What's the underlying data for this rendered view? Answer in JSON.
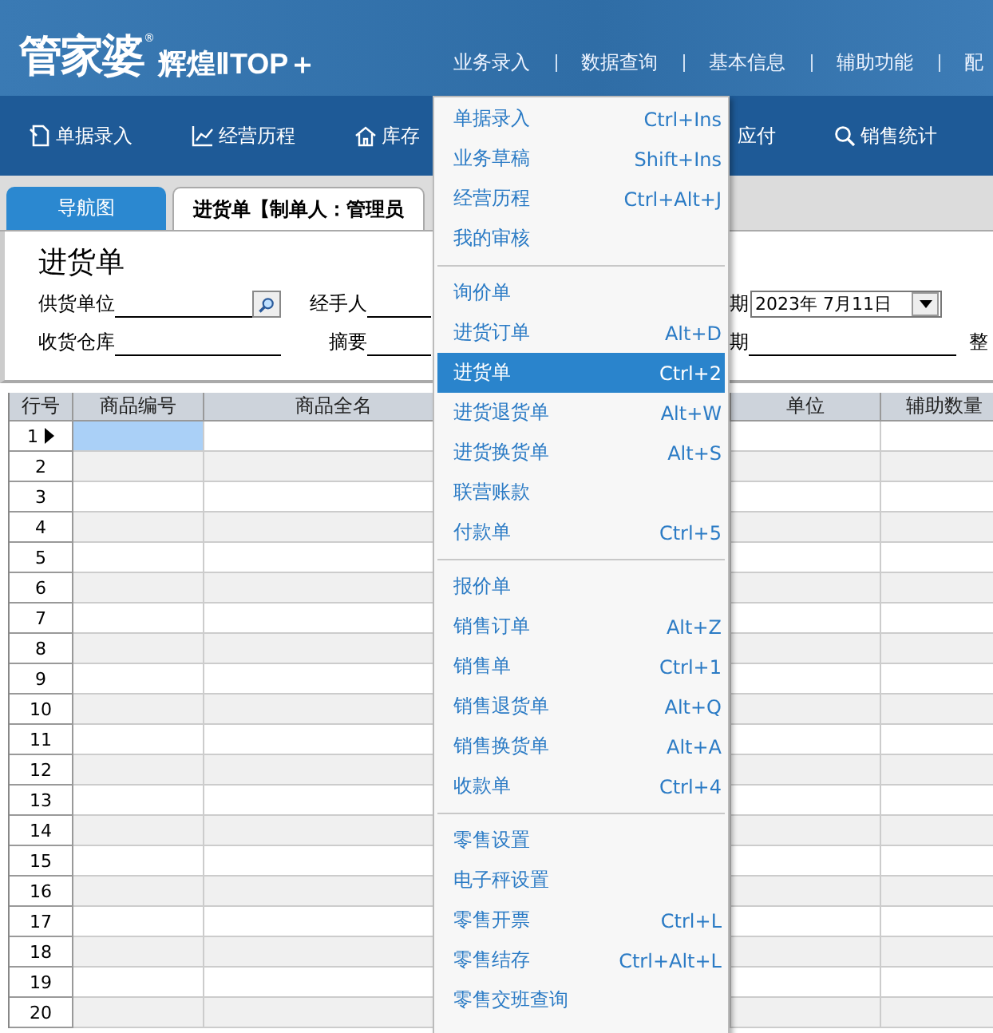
{
  "logo": {
    "brand": "管家婆",
    "mark": "®",
    "edition": "辉煌ⅡTOP＋"
  },
  "top_menu": [
    "业务录入",
    "数据查询",
    "基本信息",
    "辅助功能",
    "配"
  ],
  "toolbar": [
    "单据录入",
    "经营历程",
    "库存",
    "应付",
    "销售统计"
  ],
  "tabs": [
    {
      "label": "导航图",
      "selected": false
    },
    {
      "label": "进货单【制单人：管理员",
      "selected": true
    }
  ],
  "form": {
    "title": "进货单",
    "supplier_label": "供货单位",
    "handler_label": "经手人",
    "date_label": "期",
    "date_value": "2023年  7月11日",
    "warehouse_label": "收货仓库",
    "summary_label": "摘要",
    "date2_label": "期",
    "cut_label": "整"
  },
  "table": {
    "columns": [
      "行号",
      "商品编号",
      "商品全名",
      "单位",
      "辅助数量"
    ],
    "rows": [
      {
        "num": "1",
        "selected": true
      },
      {
        "num": "2",
        "selected": false
      },
      {
        "num": "3",
        "selected": false
      },
      {
        "num": "4",
        "selected": false
      },
      {
        "num": "5",
        "selected": false
      },
      {
        "num": "6",
        "selected": false
      },
      {
        "num": "7",
        "selected": false
      },
      {
        "num": "8",
        "selected": false
      },
      {
        "num": "9",
        "selected": false
      },
      {
        "num": "10",
        "selected": false
      },
      {
        "num": "11",
        "selected": false
      },
      {
        "num": "12",
        "selected": false
      },
      {
        "num": "13",
        "selected": false
      },
      {
        "num": "14",
        "selected": false
      },
      {
        "num": "15",
        "selected": false
      },
      {
        "num": "16",
        "selected": false
      },
      {
        "num": "17",
        "selected": false
      },
      {
        "num": "18",
        "selected": false
      },
      {
        "num": "19",
        "selected": false
      },
      {
        "num": "20",
        "selected": false
      }
    ]
  },
  "dropdown": {
    "groups": [
      [
        {
          "label": "单据录入",
          "shortcut": "Ctrl+Ins",
          "selected": false
        },
        {
          "label": "业务草稿",
          "shortcut": "Shift+Ins",
          "selected": false
        },
        {
          "label": "经营历程",
          "shortcut": "Ctrl+Alt+J",
          "selected": false
        },
        {
          "label": "我的审核",
          "selected": false
        }
      ],
      [
        {
          "label": "询价单",
          "selected": false
        },
        {
          "label": "进货订单",
          "shortcut": "Alt+D",
          "selected": false
        },
        {
          "label": "进货单",
          "shortcut": "Ctrl+2",
          "selected": true
        },
        {
          "label": "进货退货单",
          "shortcut": "Alt+W",
          "selected": false
        },
        {
          "label": "进货换货单",
          "shortcut": "Alt+S",
          "selected": false
        },
        {
          "label": "联营账款",
          "selected": false
        },
        {
          "label": "付款单",
          "shortcut": "Ctrl+5",
          "selected": false
        }
      ],
      [
        {
          "label": "报价单",
          "selected": false
        },
        {
          "label": "销售订单",
          "shortcut": "Alt+Z",
          "selected": false
        },
        {
          "label": "销售单",
          "shortcut": "Ctrl+1",
          "selected": false
        },
        {
          "label": "销售退货单",
          "shortcut": "Alt+Q",
          "selected": false
        },
        {
          "label": "销售换货单",
          "shortcut": "Alt+A",
          "selected": false
        },
        {
          "label": "收款单",
          "shortcut": "Ctrl+4",
          "selected": false
        }
      ],
      [
        {
          "label": "零售设置",
          "selected": false
        },
        {
          "label": "电子秤设置",
          "selected": false
        },
        {
          "label": "零售开票",
          "shortcut": "Ctrl+L",
          "selected": false
        },
        {
          "label": "零售结存",
          "shortcut": "Ctrl+Alt+L",
          "selected": false
        },
        {
          "label": "零售交班查询",
          "selected": false
        }
      ]
    ]
  }
}
